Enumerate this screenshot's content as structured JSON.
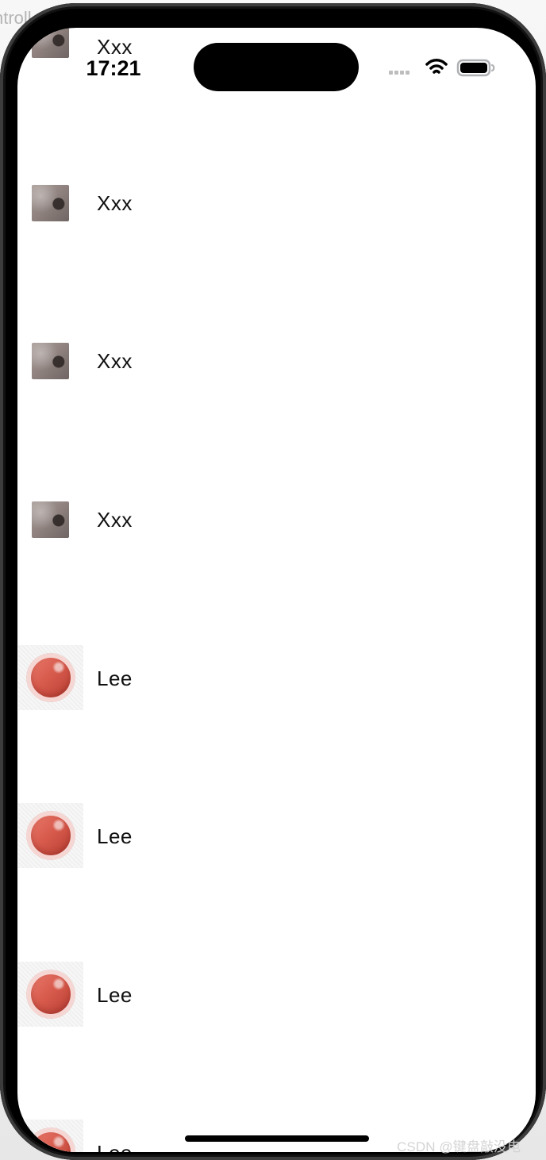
{
  "background": {
    "partial_text": "ntroll"
  },
  "status_bar": {
    "time": "17:21",
    "icons": [
      "cellular-dots-icon",
      "wifi-icon",
      "battery-icon"
    ]
  },
  "list": {
    "items": [
      {
        "label": "Xxx",
        "avatar": "photo-thumbnail"
      },
      {
        "label": "Xxx",
        "avatar": "photo-thumbnail"
      },
      {
        "label": "Xxx",
        "avatar": "photo-thumbnail"
      },
      {
        "label": "Xxx",
        "avatar": "photo-thumbnail"
      },
      {
        "label": "Lee",
        "avatar": "red-button-image"
      },
      {
        "label": "Lee",
        "avatar": "red-button-image"
      },
      {
        "label": "Lee",
        "avatar": "red-button-image"
      },
      {
        "label": "Lee",
        "avatar": "red-button-image"
      }
    ]
  },
  "watermark": "CSDN @键盘敲没电",
  "colors": {
    "screen_bg": "#ffffff",
    "device_frame": "#000000",
    "lee_avatar": "#d75a4c",
    "xxx_thumb": "#8f827f"
  }
}
